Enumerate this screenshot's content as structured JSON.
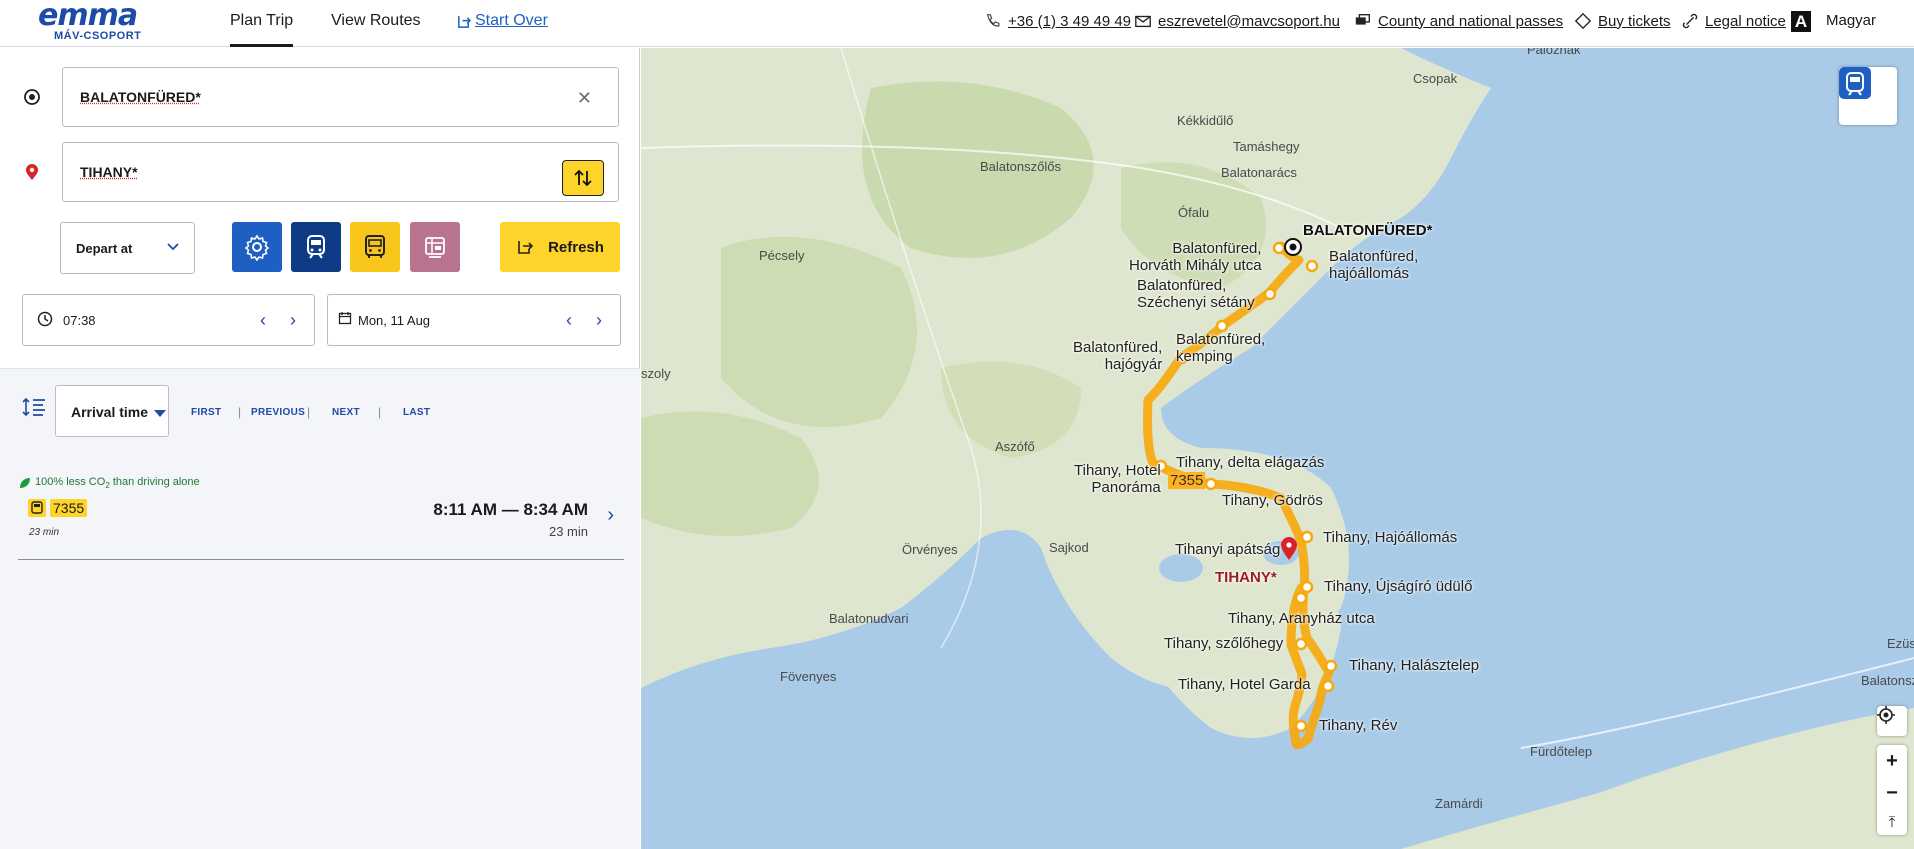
{
  "header": {
    "logo_text": "emma",
    "logo_sub": "MÁV-CSOPORT",
    "nav": {
      "plan_trip": "Plan Trip",
      "view_routes": "View Routes",
      "start_over": "Start Over"
    },
    "phone": "+36 (1) 3 49 49 49",
    "email": "eszrevetel@mavcsoport.hu",
    "passes": "County and national passes",
    "buy": "Buy tickets",
    "legal": "Legal notice",
    "a11y": "A",
    "lang": "Magyar"
  },
  "search": {
    "from": "BALATONFÜRED*",
    "to": "TIHANY*",
    "depart_label": "Depart at",
    "refresh_label": "Refresh",
    "time": "07:38",
    "date": "Mon, 11 Aug"
  },
  "results": {
    "sort_label": "Arrival time",
    "pager": {
      "first": "FIRST",
      "previous": "PREVIOUS",
      "next": "NEXT",
      "last": "LAST"
    },
    "co2_prefix": "100% less CO",
    "co2_sub": "2",
    "co2_suffix": " than driving alone",
    "routes": [
      {
        "line": "7355",
        "duration_short": "23 min",
        "times": "8:11 AM — 8:34 AM",
        "duration": "23 min"
      }
    ]
  },
  "map": {
    "places": [
      "Paloznak",
      "Csopak",
      "Kékkidűlő",
      "Tamáshegy",
      "Balatonszőlős",
      "Balatonarács",
      "Ófalu",
      "Pécsely",
      "szoly",
      "Aszófő",
      "Örvényes",
      "Sajkod",
      "Balatonudvari",
      "Fövenyes",
      "Fürdőtelep",
      "Zamárdi",
      "Ezüs",
      "Balatonszépla"
    ],
    "origin": "BALATONFÜRED*",
    "destination": "TIHANY*",
    "line": "7355",
    "stops": [
      "Balatonfüred,\nHorváth Mihály utca",
      "Balatonfüred,\nhajóállomás",
      "Balatonfüred,\nSzéchenyi sétány",
      "Balatonfüred,\nkemping",
      "Balatonfüred,\nhajógyár",
      "Tihany, delta elágazás",
      "Tihany, Hotel\nPanoráma",
      "Tihany, Gödrös",
      "Tihany, Hajóállomás",
      "Tihanyi apátság",
      "Tihany, Újságíró üdülő",
      "Tihany, Aranyház utca",
      "Tihany, szőlőhegy",
      "Tihany, Halásztelep",
      "Tihany, Hotel Garda",
      "Tihany, Rév"
    ],
    "colors": {
      "route": "#f5a90f",
      "water": "#a9cbe8",
      "land": "#dfe6cf",
      "forest": "#c4d7a6"
    }
  }
}
